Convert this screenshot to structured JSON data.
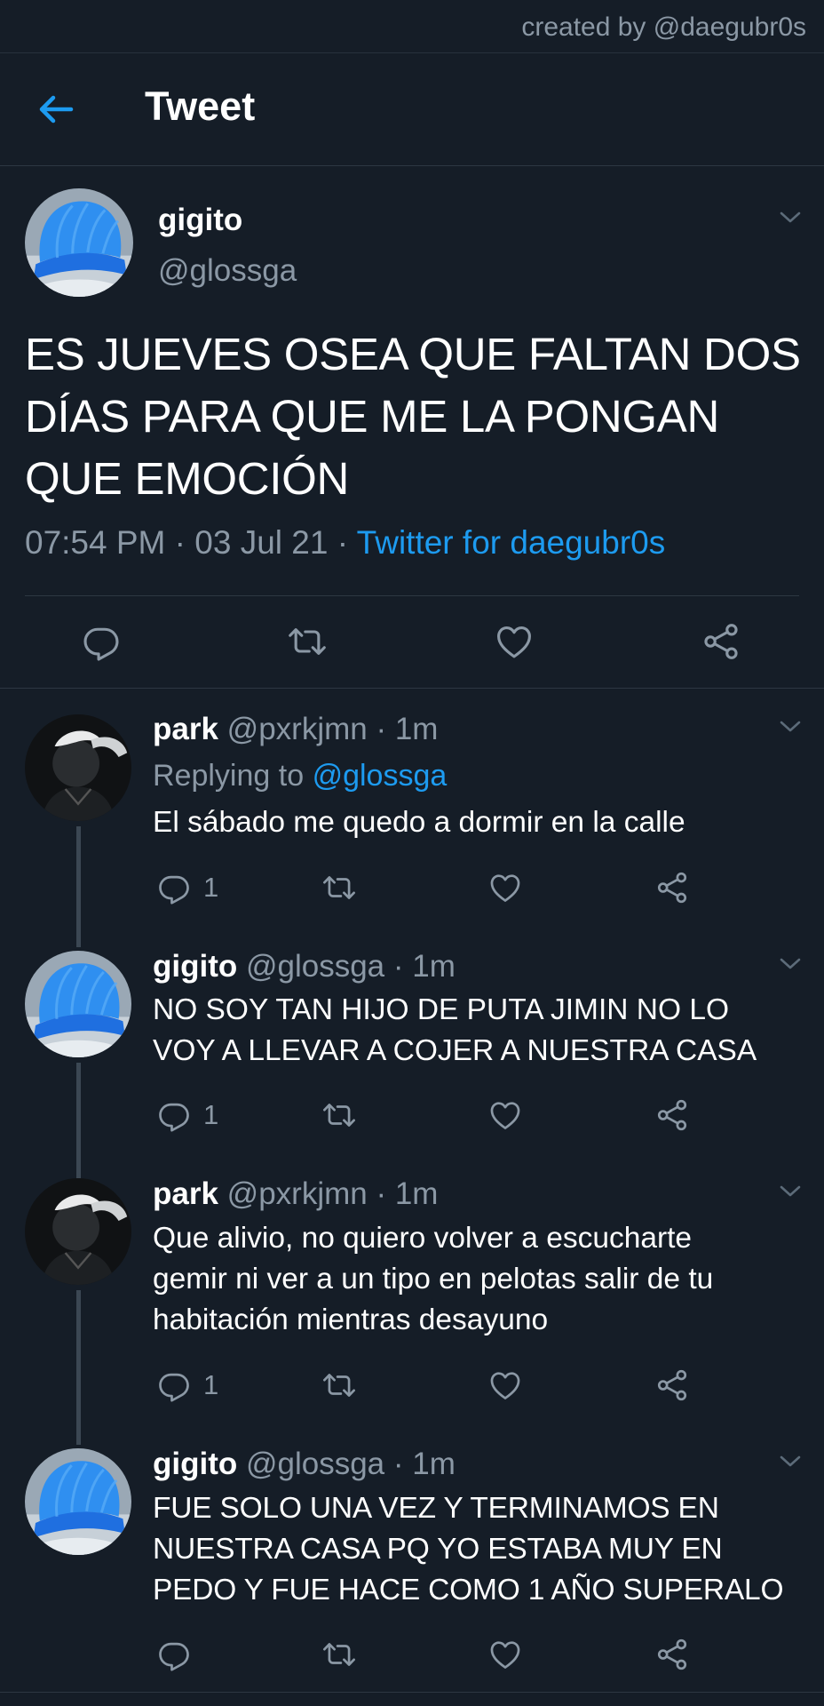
{
  "credit": "created by @daegubr0s",
  "header": {
    "title": "Tweet"
  },
  "main_tweet": {
    "name": "gigito",
    "handle": "@glossga",
    "text_lines": [
      "ES JUEVES OSEA QUE FALTAN DOS",
      "DÍAS PARA QUE ME LA PONGAN",
      "QUE EMOCIÓN"
    ],
    "time": "07:54 PM",
    "date": "03 Jul 21",
    "source": "Twitter for daegubr0s"
  },
  "replies": [
    {
      "name": "park",
      "handle": "@pxrkjmn",
      "time": "1m",
      "replying_to_label": "Replying to",
      "replying_to_handle": "@glossga",
      "text_lines": [
        "El sábado me quedo a dormir en la calle"
      ],
      "reply_count": "1"
    },
    {
      "name": "gigito",
      "handle": "@glossga",
      "time": "1m",
      "text_lines": [
        "NO SOY TAN HIJO DE PUTA JIMIN NO LO",
        "VOY A LLEVAR A COJER A NUESTRA CASA"
      ],
      "reply_count": "1"
    },
    {
      "name": "park",
      "handle": "@pxrkjmn",
      "time": "1m",
      "text_lines": [
        "Que alivio, no quiero volver a escucharte",
        "gemir ni ver a un tipo en pelotas salir de tu",
        "habitación mientras desayuno"
      ],
      "reply_count": "1"
    },
    {
      "name": "gigito",
      "handle": "@glossga",
      "time": "1m",
      "text_lines": [
        "FUE SOLO UNA VEZ Y TERMINAMOS EN",
        "NUESTRA CASA PQ YO ESTABA MUY EN",
        "PEDO Y FUE HACE COMO 1 AÑO SUPERALO"
      ],
      "reply_count": ""
    }
  ],
  "separators": {
    "dot": "·"
  },
  "icons": [
    "back-arrow-icon",
    "chevron-down-icon",
    "reply-icon",
    "retweet-icon",
    "like-icon",
    "share-icon"
  ],
  "colors": {
    "background": "#151d27",
    "accent": "#1d9bf0",
    "secondary_text": "#8b98a5"
  }
}
